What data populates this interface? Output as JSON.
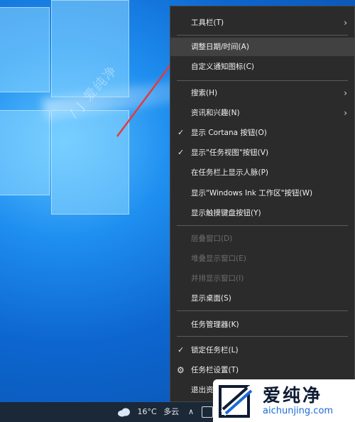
{
  "menu": {
    "items": [
      {
        "label": "工具栏(T)",
        "has_submenu": true
      },
      {
        "label": "调整日期/时间(A)",
        "highlighted": true
      },
      {
        "label": "自定义通知图标(C)"
      },
      {
        "label": "搜索(H)",
        "has_submenu": true
      },
      {
        "label": "资讯和兴趣(N)",
        "has_submenu": true
      },
      {
        "label": "显示 Cortana 按钮(O)",
        "checked": true
      },
      {
        "label": "显示\"任务视图\"按钮(V)",
        "checked": true
      },
      {
        "label": "在任务栏上显示人脉(P)"
      },
      {
        "label": "显示\"Windows Ink 工作区\"按钮(W)"
      },
      {
        "label": "显示触摸键盘按钮(Y)"
      },
      {
        "label": "层叠窗口(D)",
        "disabled": true
      },
      {
        "label": "堆叠显示窗口(E)",
        "disabled": true
      },
      {
        "label": "并排显示窗口(I)",
        "disabled": true
      },
      {
        "label": "显示桌面(S)"
      },
      {
        "label": "任务管理器(K)"
      },
      {
        "label": "锁定任务栏(L)",
        "checked": true
      },
      {
        "label": "任务栏设置(T)",
        "icon": "gear-icon"
      },
      {
        "label": "退出资"
      }
    ],
    "check_glyph": "✓",
    "gear_glyph": "⚙",
    "submenu_glyph": "›"
  },
  "taskbar": {
    "weather_temp": "16°C",
    "weather_desc": "多云",
    "chevron": "∧"
  },
  "watermark": {
    "diag_text": "/ J 爱纯净",
    "logo_cn": "爱纯净",
    "logo_en": "aichunjing.com"
  },
  "colors": {
    "menu_bg": "#2b2b2b",
    "menu_highlight": "#414141",
    "arrow": "#e23b3b",
    "taskbar": "#1b2838"
  }
}
